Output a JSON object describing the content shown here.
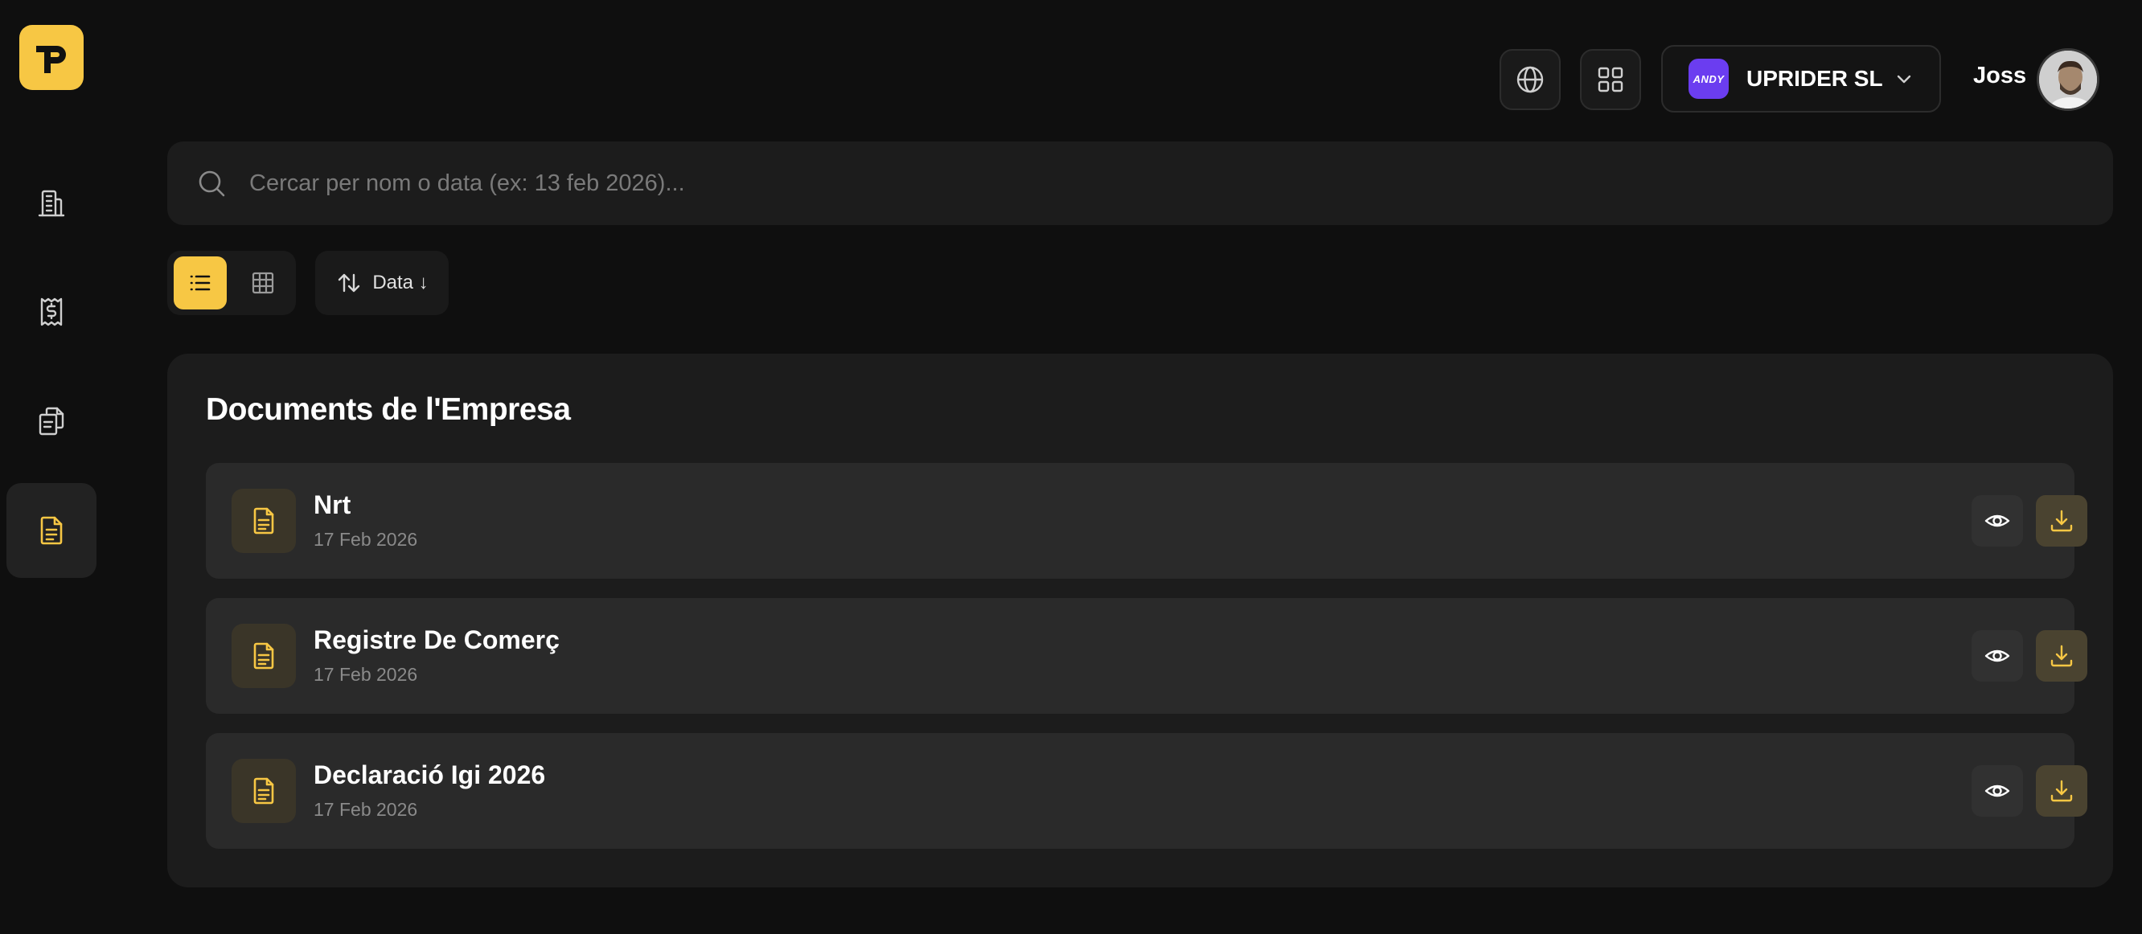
{
  "brand": {
    "logo_icon": "p-monogram-logo",
    "accent": "#f7c744"
  },
  "sidebar": {
    "items": [
      {
        "id": "companies",
        "icon": "building-icon",
        "active": false
      },
      {
        "id": "invoices",
        "icon": "receipt-dollar-icon",
        "active": false
      },
      {
        "id": "copies",
        "icon": "copy-documents-icon",
        "active": false
      },
      {
        "id": "documents",
        "icon": "document-icon",
        "active": true
      }
    ]
  },
  "header": {
    "language_icon": "globe-icon",
    "apps_icon": "grid-icon",
    "company": {
      "logo_text": "ANDY",
      "name": "UPRIDER SL",
      "logo_color": "#6b3df0"
    },
    "user": {
      "name": "Joss"
    }
  },
  "search": {
    "placeholder": "Cercar per nom o data (ex: 13 feb 2026)...",
    "value": ""
  },
  "toolbar": {
    "view_modes": [
      "list",
      "grid"
    ],
    "active_view": "list",
    "sort_label": "Data ↓"
  },
  "documents_panel": {
    "title": "Documents de l'Empresa",
    "items": [
      {
        "name": "Nrt",
        "date": "17 Feb 2026"
      },
      {
        "name": "Registre De Comerç",
        "date": "17 Feb 2026"
      },
      {
        "name": "Declaració Igi 2026",
        "date": "17 Feb 2026"
      }
    ]
  }
}
